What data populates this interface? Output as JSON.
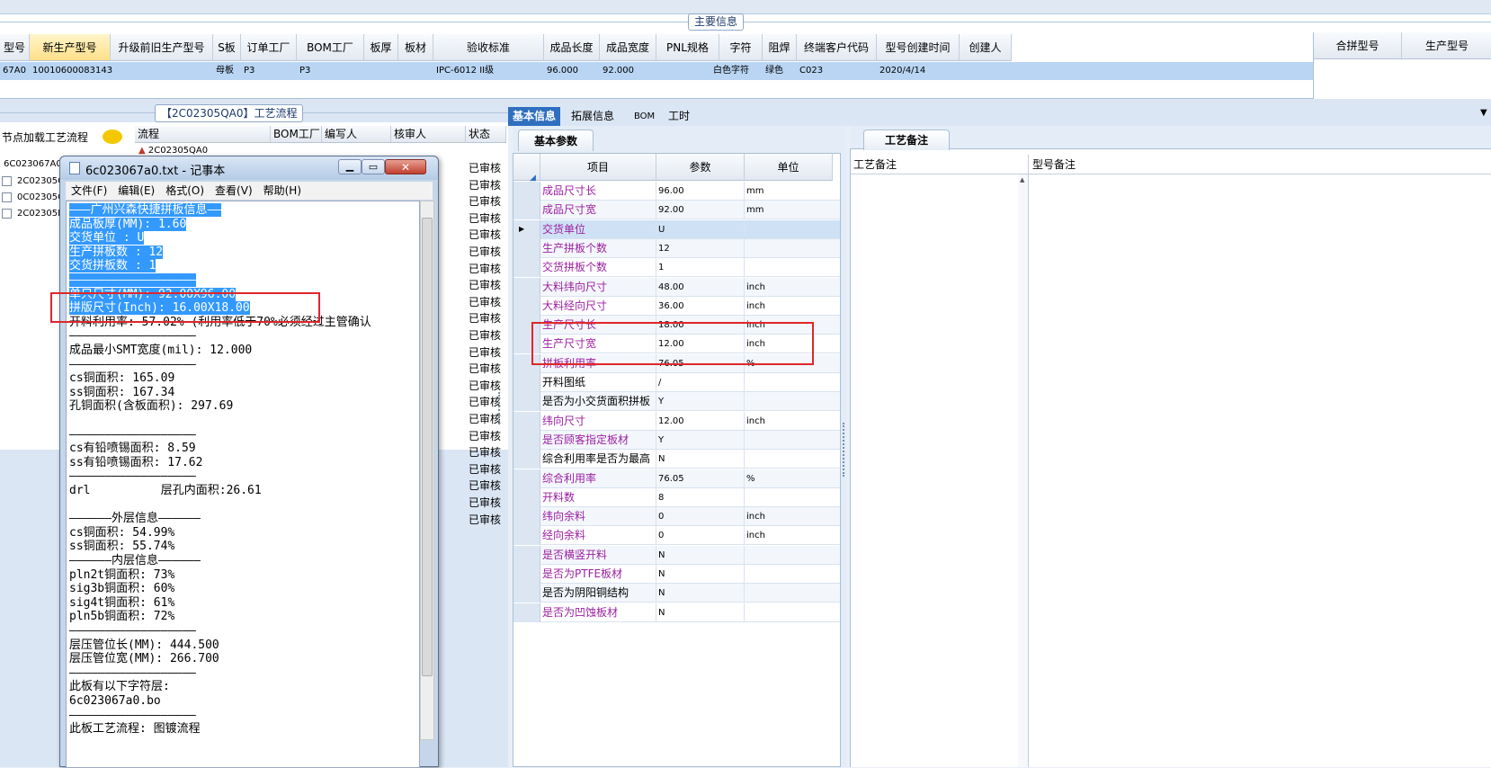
{
  "top": {
    "group_title": "主要信息",
    "headers": [
      "型号",
      "新生产型号",
      "升级前旧生产型号",
      "S板",
      "订单工厂",
      "BOM工厂",
      "板厚",
      "板材",
      "验收标准",
      "成品长度",
      "成品宽度",
      "PNL规格",
      "字符",
      "阻焊",
      "终端客户代码",
      "型号创建时间",
      "创建人"
    ],
    "row": [
      "67A0",
      "10010600083143",
      "",
      "母板",
      "P3",
      "P3",
      "",
      "",
      "IPC-6012 II级",
      "96.000",
      "92.000",
      "",
      "白色字符",
      "绿色",
      "C023",
      "2020/4/14",
      ""
    ],
    "right_headers": [
      "合拼型号",
      "生产型号"
    ]
  },
  "left": {
    "group_title": "【2C02305QA0】工艺流程",
    "tree_header": "节点加载工艺流程",
    "tree_items": [
      "6C023067A0",
      "2C02305Q",
      "0C02305G",
      "2C02305R"
    ],
    "headers": [
      "流程",
      "BOM工厂",
      "编写人",
      "核审人",
      "状态"
    ],
    "first_flow": "2C02305QA0",
    "status_label": "已审核"
  },
  "notepad": {
    "title": "6c023067a0.txt - 记事本",
    "menu": [
      "文件(F)",
      "编辑(E)",
      "格式(O)",
      "查看(V)",
      "帮助(H)"
    ],
    "lines": [
      "———广州兴森快捷拼板信息——",
      "成品板厚(MM): 1.60",
      "交货单位 : U",
      "生产拼板数 : 12",
      "交货拼板数 : 1",
      "——————————————————",
      "单只尺寸(MM): 92.00X96.00",
      "拼版尺寸(Inch): 16.00X18.00",
      "开料利用率: 57.02% (利用率低于70%必须经过主管确认",
      "——————————————————",
      "成品最小SMT宽度(mil): 12.000",
      "——————————————————",
      "cs铜面积: 165.09",
      "ss铜面积: 167.34",
      "孔铜面积(含板面积): 297.69",
      "",
      "——————————————————",
      "cs有铅喷锡面积: 8.59",
      "ss有铅喷锡面积: 17.62",
      "——————————————————",
      "drl          层孔内面积:26.61",
      "",
      "——————外层信息——————",
      "cs铜面积: 54.99%",
      "ss铜面积: 55.74%",
      "——————内层信息——————",
      "pln2t铜面积: 73%",
      "sig3b铜面积: 60%",
      "sig4t铜面积: 61%",
      "pln5b铜面积: 72%",
      "——————————————————",
      "层压管位长(MM): 444.500",
      "层压管位宽(MM): 266.700",
      "——————————————————",
      "此板有以下字符层:",
      "6c023067a0.bo",
      "——————————————————",
      "此板工艺流程: 图镀流程"
    ]
  },
  "tabs": [
    "基本信息",
    "拓展信息",
    "BOM",
    "工时"
  ],
  "basic": {
    "subtab": "基本参数",
    "headers": [
      "项目",
      "参数",
      "单位"
    ],
    "rows": [
      {
        "name": "成品尺寸长",
        "value": "96.00",
        "unit": "mm",
        "purple": true
      },
      {
        "name": "成品尺寸宽",
        "value": "92.00",
        "unit": "mm",
        "purple": true
      },
      {
        "name": "交货单位",
        "value": "U",
        "unit": "",
        "purple": true
      },
      {
        "name": "生产拼板个数",
        "value": "12",
        "unit": "",
        "purple": true
      },
      {
        "name": "交货拼板个数",
        "value": "1",
        "unit": "",
        "purple": true
      },
      {
        "name": "大料纬向尺寸",
        "value": "48.00",
        "unit": "inch",
        "purple": true
      },
      {
        "name": "大料经向尺寸",
        "value": "36.00",
        "unit": "inch",
        "purple": true
      },
      {
        "name": "生产尺寸长",
        "value": "18.00",
        "unit": "inch",
        "purple": true
      },
      {
        "name": "生产尺寸宽",
        "value": "12.00",
        "unit": "inch",
        "purple": true
      },
      {
        "name": "拼板利用率",
        "value": "76.05",
        "unit": "%",
        "purple": true
      },
      {
        "name": "开料图纸",
        "value": "/",
        "unit": "",
        "purple": false
      },
      {
        "name": "是否为小交货面积拼板",
        "value": "Y",
        "unit": "",
        "purple": false
      },
      {
        "name": "纬向尺寸",
        "value": "12.00",
        "unit": "inch",
        "purple": true
      },
      {
        "name": "是否顾客指定板材",
        "value": "Y",
        "unit": "",
        "purple": true
      },
      {
        "name": "综合利用率是否为最高",
        "value": "N",
        "unit": "",
        "purple": false
      },
      {
        "name": "综合利用率",
        "value": "76.05",
        "unit": "%",
        "purple": true
      },
      {
        "name": "开料数",
        "value": "8",
        "unit": "",
        "purple": true
      },
      {
        "name": "纬向余料",
        "value": "0",
        "unit": "inch",
        "purple": true
      },
      {
        "name": "经向余料",
        "value": "0",
        "unit": "inch",
        "purple": true
      },
      {
        "name": "是否横竖开料",
        "value": "N",
        "unit": "",
        "purple": true
      },
      {
        "name": "是否为PTFE板材",
        "value": "N",
        "unit": "",
        "purple": true
      },
      {
        "name": "是否为阴阳铜结构",
        "value": "N",
        "unit": "",
        "purple": false
      },
      {
        "name": "是否为凹蚀板材",
        "value": "N",
        "unit": "",
        "purple": true
      }
    ]
  },
  "remarks": {
    "tab": "工艺备注",
    "col1": "工艺备注",
    "col2": "型号备注"
  },
  "colors": {
    "selection": "#3399ff",
    "highlight_box": "#e0262b",
    "purple_label": "#9b1fa0",
    "active_tab": "#2f6fbf"
  }
}
